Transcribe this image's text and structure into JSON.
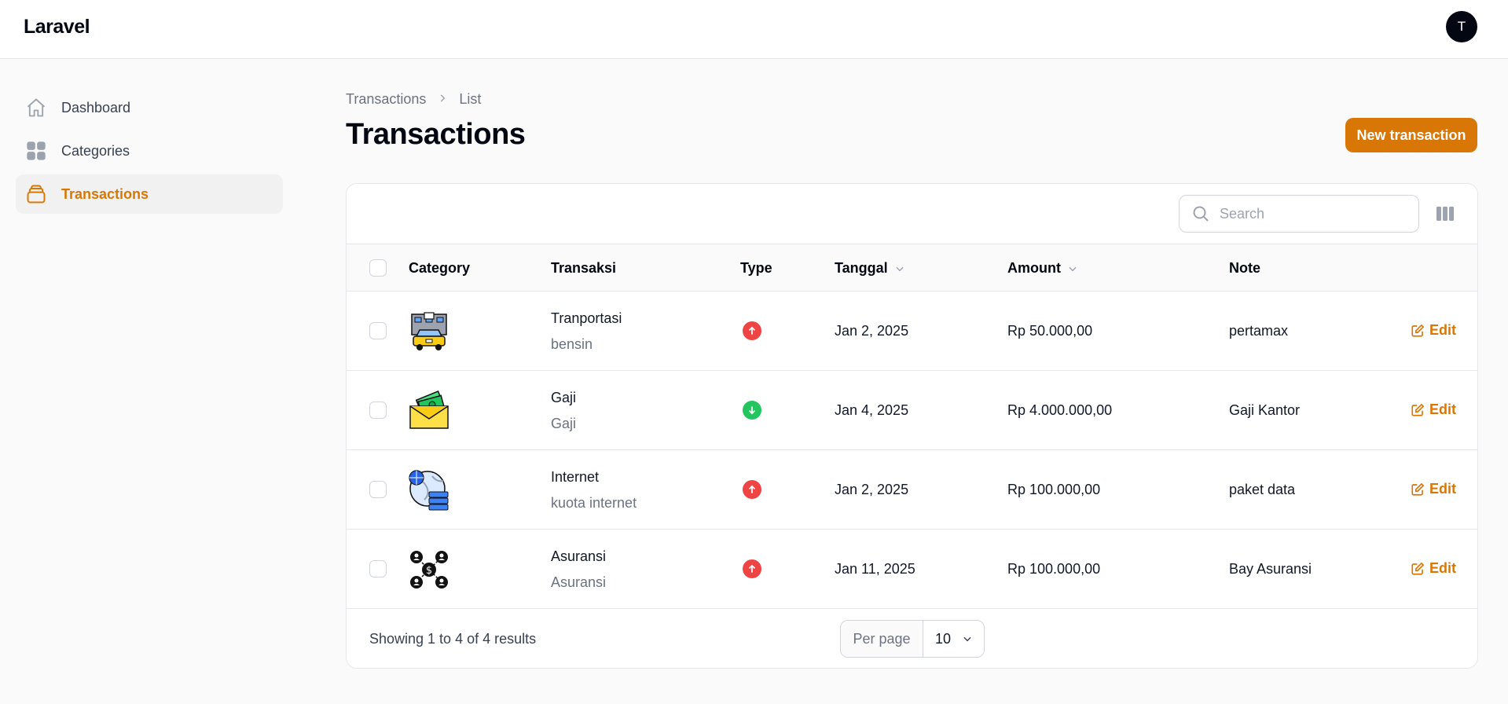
{
  "app": {
    "brand": "Laravel",
    "user_initial": "T"
  },
  "sidebar": {
    "items": [
      {
        "label": "Dashboard",
        "icon": "home-icon",
        "active": false
      },
      {
        "label": "Categories",
        "icon": "grid-icon",
        "active": false
      },
      {
        "label": "Transactions",
        "icon": "stack-icon",
        "active": true
      }
    ]
  },
  "breadcrumb": {
    "items": [
      "Transactions",
      "List"
    ]
  },
  "page": {
    "title": "Transactions",
    "new_button": "New transaction"
  },
  "toolbar": {
    "search_placeholder": "Search",
    "search_value": ""
  },
  "table": {
    "headers": {
      "category": "Category",
      "transaksi": "Transaksi",
      "type": "Type",
      "tanggal": "Tanggal",
      "amount": "Amount",
      "note": "Note"
    },
    "edit_label": "Edit",
    "rows": [
      {
        "category_icon": "car-icon",
        "title": "Tranportasi",
        "subtitle": "bensin",
        "type": "up",
        "date": "Jan 2, 2025",
        "amount": "Rp 50.000,00",
        "note": "pertamax"
      },
      {
        "category_icon": "money-envelope-icon",
        "title": "Gaji",
        "subtitle": "Gaji",
        "type": "down",
        "date": "Jan 4, 2025",
        "amount": "Rp 4.000.000,00",
        "note": "Gaji Kantor"
      },
      {
        "category_icon": "globe-server-icon",
        "title": "Internet",
        "subtitle": "kuota internet",
        "type": "up",
        "date": "Jan 2, 2025",
        "amount": "Rp 100.000,00",
        "note": "paket data"
      },
      {
        "category_icon": "insurance-network-icon",
        "title": "Asuransi",
        "subtitle": "Asuransi",
        "type": "up",
        "date": "Jan 11, 2025",
        "amount": "Rp 100.000,00",
        "note": "Bay Asuransi"
      }
    ]
  },
  "pagination": {
    "summary": "Showing 1 to 4 of 4 results",
    "per_page_label": "Per page",
    "per_page_value": "10"
  },
  "colors": {
    "accent": "#d97706",
    "expense": "#ef4444",
    "income": "#22c55e"
  }
}
